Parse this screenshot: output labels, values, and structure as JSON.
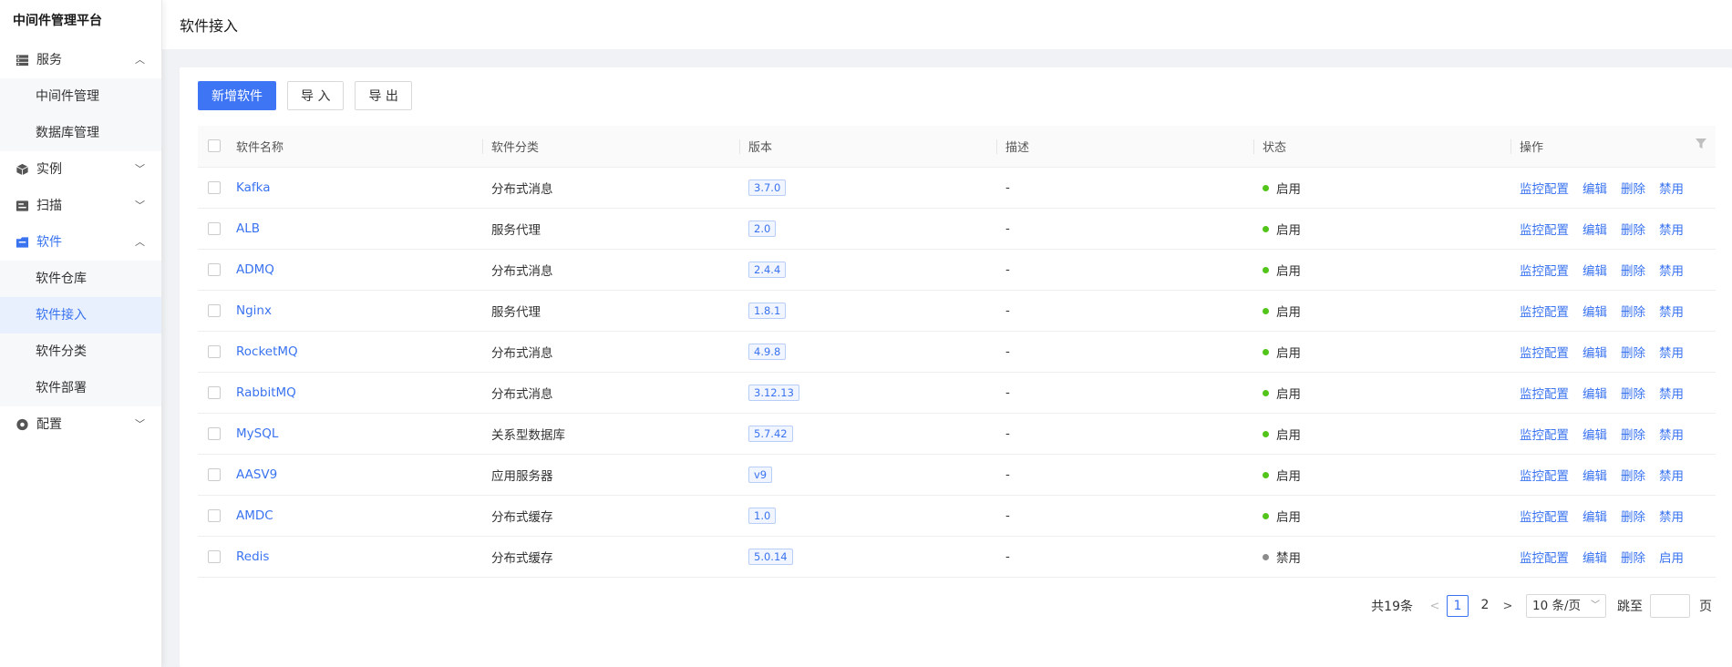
{
  "app": {
    "title": "中间件管理平台"
  },
  "sidebar": {
    "groups": [
      {
        "label": "服务",
        "icon": "server-icon",
        "expanded": true,
        "children": [
          {
            "label": "中间件管理"
          },
          {
            "label": "数据库管理"
          }
        ]
      },
      {
        "label": "实例",
        "icon": "cube-icon",
        "expanded": false
      },
      {
        "label": "扫描",
        "icon": "scan-icon",
        "expanded": false
      },
      {
        "label": "软件",
        "icon": "folder-icon",
        "expanded": true,
        "active": true,
        "children": [
          {
            "label": "软件仓库"
          },
          {
            "label": "软件接入",
            "active": true
          },
          {
            "label": "软件分类"
          },
          {
            "label": "软件部署"
          }
        ]
      },
      {
        "label": "配置",
        "icon": "settings-icon",
        "expanded": false
      }
    ]
  },
  "header": {
    "title": "软件接入"
  },
  "toolbar": {
    "add_label": "新增软件",
    "import_label": "导 入",
    "export_label": "导 出"
  },
  "table": {
    "columns": [
      "软件名称",
      "软件分类",
      "版本",
      "描述",
      "状态",
      "操作"
    ],
    "rows": [
      {
        "name": "Kafka",
        "category": "分布式消息",
        "version": "3.7.0",
        "desc": "-",
        "status": "启用",
        "ops": [
          "监控配置",
          "编辑",
          "删除",
          "禁用"
        ]
      },
      {
        "name": "ALB",
        "category": "服务代理",
        "version": "2.0",
        "desc": "-",
        "status": "启用",
        "ops": [
          "监控配置",
          "编辑",
          "删除",
          "禁用"
        ]
      },
      {
        "name": "ADMQ",
        "category": "分布式消息",
        "version": "2.4.4",
        "desc": "-",
        "status": "启用",
        "ops": [
          "监控配置",
          "编辑",
          "删除",
          "禁用"
        ]
      },
      {
        "name": "Nginx",
        "category": "服务代理",
        "version": "1.8.1",
        "desc": "-",
        "status": "启用",
        "ops": [
          "监控配置",
          "编辑",
          "删除",
          "禁用"
        ]
      },
      {
        "name": "RocketMQ",
        "category": "分布式消息",
        "version": "4.9.8",
        "desc": "-",
        "status": "启用",
        "ops": [
          "监控配置",
          "编辑",
          "删除",
          "禁用"
        ]
      },
      {
        "name": "RabbitMQ",
        "category": "分布式消息",
        "version": "3.12.13",
        "desc": "-",
        "status": "启用",
        "ops": [
          "监控配置",
          "编辑",
          "删除",
          "禁用"
        ]
      },
      {
        "name": "MySQL",
        "category": "关系型数据库",
        "version": "5.7.42",
        "desc": "-",
        "status": "启用",
        "ops": [
          "监控配置",
          "编辑",
          "删除",
          "禁用"
        ]
      },
      {
        "name": "AASV9",
        "category": "应用服务器",
        "version": "v9",
        "desc": "-",
        "status": "启用",
        "ops": [
          "监控配置",
          "编辑",
          "删除",
          "禁用"
        ]
      },
      {
        "name": "AMDC",
        "category": "分布式缓存",
        "version": "1.0",
        "desc": "-",
        "status": "启用",
        "ops": [
          "监控配置",
          "编辑",
          "删除",
          "禁用"
        ]
      },
      {
        "name": "Redis",
        "category": "分布式缓存",
        "version": "5.0.14",
        "desc": "-",
        "status": "禁用",
        "ops": [
          "监控配置",
          "编辑",
          "删除",
          "启用"
        ]
      }
    ]
  },
  "status_colors": {
    "启用": "#52c41a",
    "禁用": "#8c8c8c"
  },
  "pagination": {
    "total_text": "共19条",
    "pages": [
      "1",
      "2"
    ],
    "current": "1",
    "page_size": "10 条/页",
    "jump_label": "跳至",
    "page_unit": "页"
  },
  "colors": {
    "accent": "#3d75f5"
  }
}
